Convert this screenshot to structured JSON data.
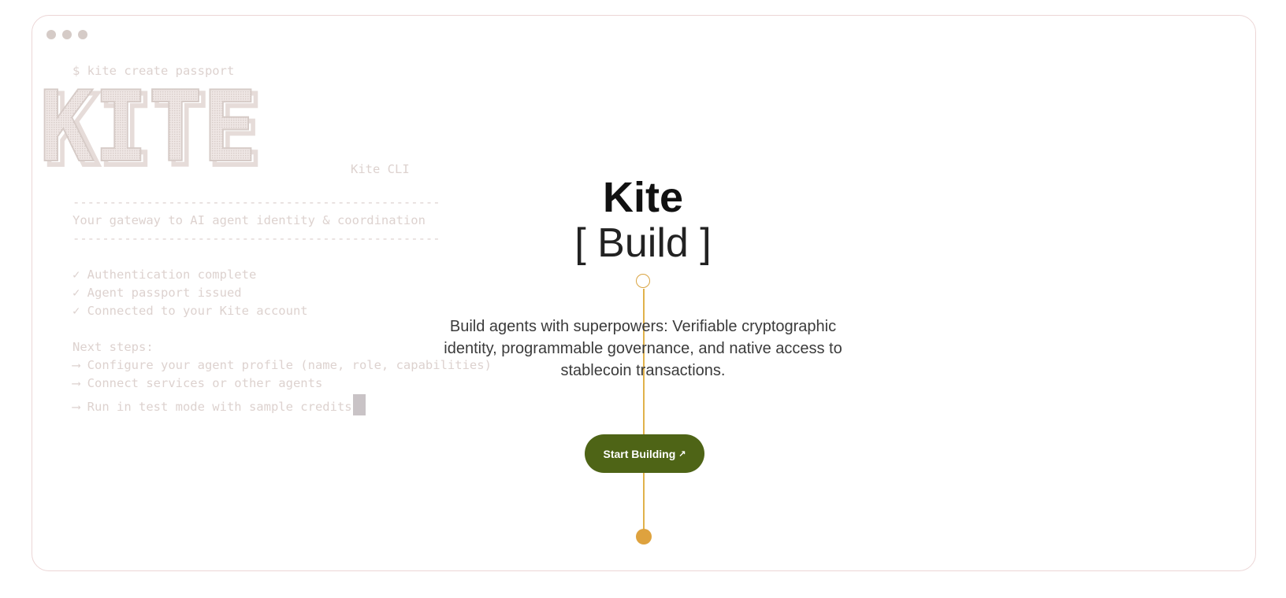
{
  "window": {
    "dots": [
      "close",
      "minimize",
      "maximize"
    ]
  },
  "terminal": {
    "command": "$ kite create passport",
    "ascii_logo": "KITE",
    "cli_label": "Kite CLI",
    "divider": "--------------------------------------------------",
    "tagline": "Your gateway to AI agent identity & coordination",
    "checks": [
      "✓ Authentication complete",
      "✓ Agent passport issued",
      "✓ Connected to your Kite account"
    ],
    "next_steps_header": "Next steps:",
    "next_steps": [
      "⟶ Configure your agent profile (name, role, capabilities)",
      "⟶ Connect services or other agents",
      "⟶ Run in test mode with sample credits"
    ]
  },
  "hero": {
    "title": "Kite",
    "subtitle": "[ Build ]",
    "description": "Build agents with superpowers: Verifiable cryptographic identity, programmable governance, and native access to stablecoin transactions.",
    "cta_label": "Start Building",
    "cta_icon": "arrow-up-right-icon"
  },
  "colors": {
    "accent_gold": "#dea23e",
    "cta_green": "#4e6416",
    "terminal_text": "#ddd2cf",
    "window_border": "#ecd6d6"
  }
}
